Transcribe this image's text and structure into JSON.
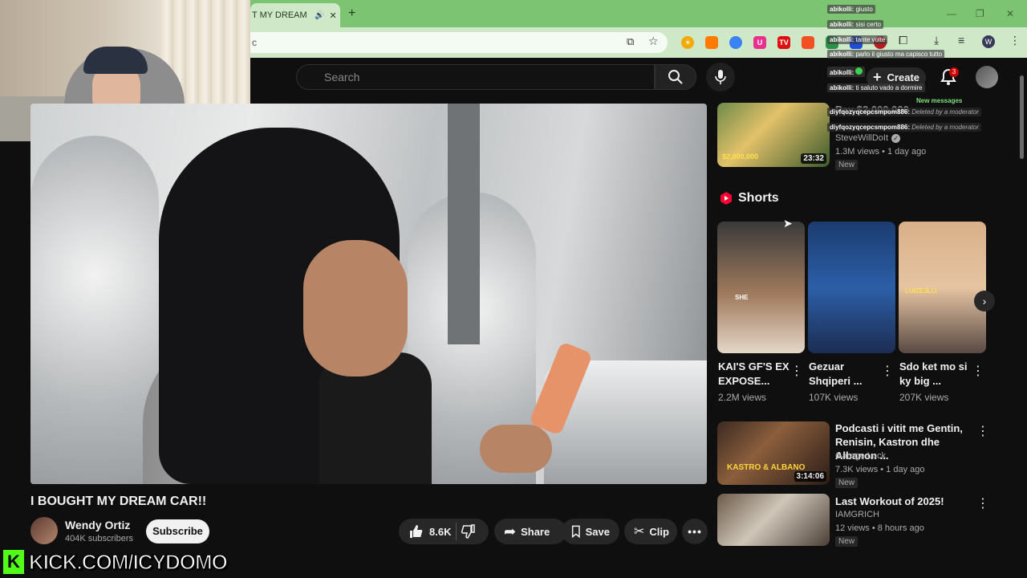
{
  "browser": {
    "tab_title": "T MY DREAM C",
    "omnibox_text": "c"
  },
  "youtube": {
    "search_placeholder": "Search",
    "create_label": "Create",
    "notification_count": "3"
  },
  "video": {
    "title": "I BOUGHT MY DREAM CAR!!",
    "channel_name": "Wendy Ortiz",
    "subscribers": "404K subscribers",
    "subscribe_label": "Subscribe",
    "likes": "8.6K",
    "share_label": "Share",
    "save_label": "Save",
    "clip_label": "Clip"
  },
  "sidebar": {
    "top_video": {
      "title": "$2,000,000",
      "title_partial": "Pay",
      "channel": "SteveWillDoIt",
      "meta": "1.3M views • 1 day ago",
      "badge": "New",
      "duration": "23:32",
      "thumb_text": "$2,000,000"
    },
    "shorts_heading": "Shorts",
    "shorts": [
      {
        "title": "KAI'S GF'S EX EXPOSE...",
        "views": "2.2M views",
        "overlay": "SHE"
      },
      {
        "title": "Gezuar Shqiperi ...",
        "views": "107K views"
      },
      {
        "title": "Sdo ket mo si ky big ...",
        "views": "207K views",
        "overlay": "LUIZEJLLI"
      }
    ],
    "videos": [
      {
        "title": "Podcasti i vitit me Gentin, Renisin, Kastron dhe Albanon ...",
        "channel": "Garage Lock",
        "meta": "7.3K views • 1 day ago",
        "badge": "New",
        "duration": "3:14:06",
        "thumb_text": "KASTRO & ALBANO"
      },
      {
        "title": "Last Workout of 2025!",
        "channel": "IAMGRICH",
        "meta": "12 views • 8 hours ago",
        "badge": "New"
      }
    ]
  },
  "chat": {
    "messages": [
      {
        "user": "abikolli:",
        "text": "giusto"
      },
      {
        "user": "abikolli:",
        "text": "sisi certo"
      },
      {
        "user": "abikolli:",
        "text": "tante volte"
      },
      {
        "user": "abikolli:",
        "text": "parlo il giusto ma capisco tutto"
      },
      {
        "user": "abikolli:",
        "text": ""
      },
      {
        "user": "abikolli:",
        "text": "ti saluto vado a dormire"
      }
    ],
    "new_messages_label": "New messages",
    "deleted": [
      {
        "user": "diyfqozyqcepcsmpom886:",
        "text": "Deleted by a moderator"
      },
      {
        "user": "diyfqozyqcepcsmpom886:",
        "text": "Deleted by a moderator"
      }
    ]
  },
  "stream": {
    "kick_logo": "K",
    "kick_url": "KICK.COM/ICYDOMO"
  },
  "colors": {
    "tab_bar": "#7cc472",
    "kick_green": "#53fc18",
    "yt_background": "#0f0f0f",
    "shorts_red": "#ff0033"
  }
}
